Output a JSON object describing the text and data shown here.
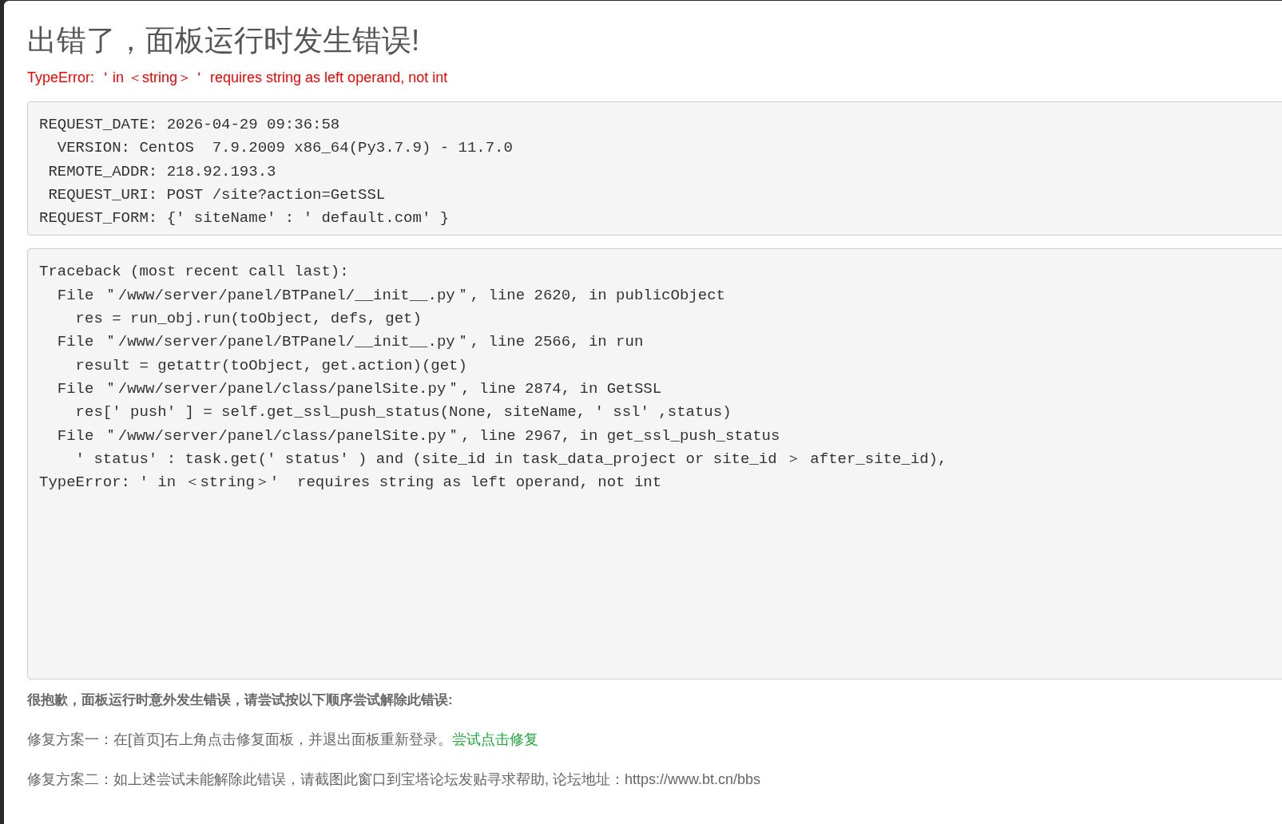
{
  "title": "出错了，面板运行时发生错误!",
  "error_message": "TypeError: ＇in ＜string＞＇ requires string as left operand, not int",
  "request_info": [
    "REQUEST_DATE: 2026-04-29 09:36:58",
    "  VERSION: CentOS  7.9.2009 x86_64(Py3.7.9) - 11.7.0",
    " REMOTE_ADDR: 218.92.193.3",
    " REQUEST_URI: POST /site?action=GetSSL",
    "REQUEST_FORM: {′ siteName′ : ′ default.com′ }"
  ],
  "traceback": [
    "Traceback (most recent call last):",
    "  File ＂/www/server/panel/BTPanel/__init__.py＂, line 2620, in publicObject",
    "    res = run_obj.run(toObject, defs, get)",
    "  File ＂/www/server/panel/BTPanel/__init__.py＂, line 2566, in run",
    "    result = getattr(toObject, get.action)(get)",
    "  File ＂/www/server/panel/class/panelSite.py＂, line 2874, in GetSSL",
    "    res[′ push′ ] = self.get_ssl_push_status(None, siteName, ′ ssl′ ,status)",
    "  File ＂/www/server/panel/class/panelSite.py＂, line 2967, in get_ssl_push_status",
    "    ′ status′ : task.get(′ status′ ) and (site_id in task_data_project or site_id ＞ after_site_id),",
    "TypeError: ′ in ＜string＞′  requires string as left operand, not int"
  ],
  "help_heading": "很抱歉，面板运行时意外发生错误，请尝试按以下顺序尝试解除此错误:",
  "fix_one": {
    "text": "修复方案一：在[首页]右上角点击修复面板，并退出面板重新登录。",
    "link": "尝试点击修复"
  },
  "fix_two": "修复方案二：如上述尝试未能解除此错误，请截图此窗口到宝塔论坛发贴寻求帮助, 论坛地址：https://www.bt.cn/bbs"
}
